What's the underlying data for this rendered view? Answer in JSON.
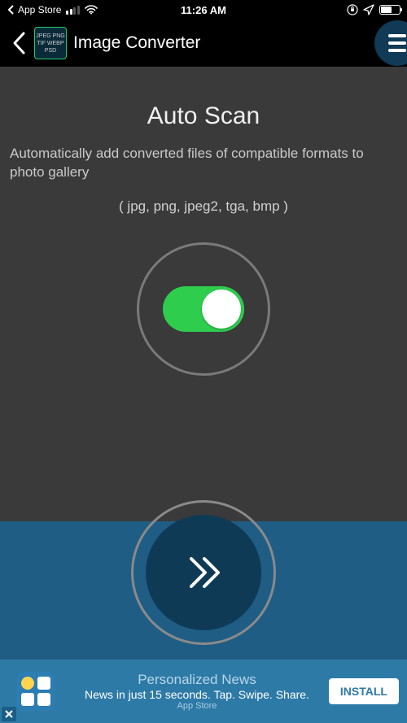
{
  "status": {
    "back_app": "App Store",
    "time": "11:26 AM"
  },
  "nav": {
    "title": "Image Converter",
    "icon_text": "JPEG PNG TIF WEBP PSD"
  },
  "main": {
    "heading": "Auto Scan",
    "description": "Automatically add converted files of compatible formats to photo gallery",
    "formats": "( jpg, png, jpeg2, tga, bmp )",
    "toggle_on": true
  },
  "ad": {
    "title": "Personalized News",
    "subtitle": "News in just 15 seconds. Tap. Swipe. Share.",
    "store": "App Store",
    "cta": "INSTALL"
  }
}
